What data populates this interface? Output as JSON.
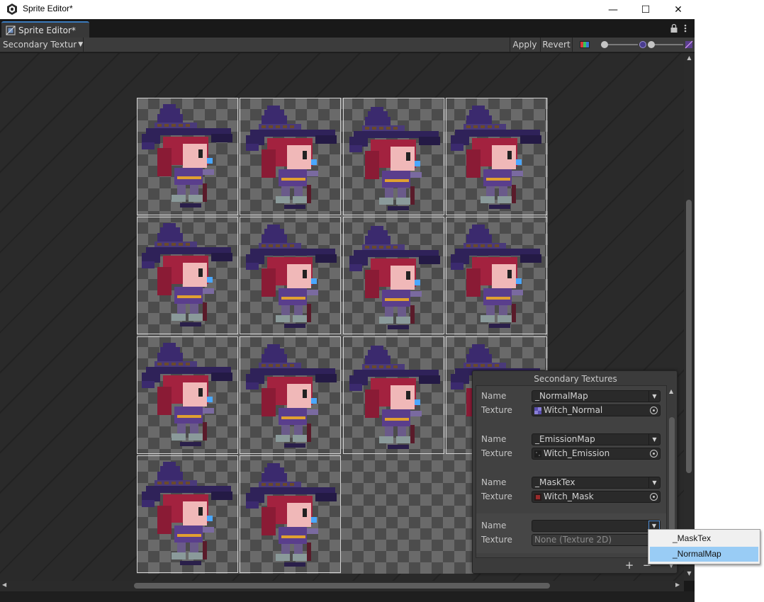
{
  "window": {
    "title": "Sprite Editor*",
    "minimize_glyph": "—",
    "maximize_glyph": "☐",
    "close_glyph": "✕"
  },
  "tab": {
    "label": "Sprite Editor*"
  },
  "toolbar": {
    "mode_label": "Secondary Textur",
    "apply_label": "Apply",
    "revert_label": "Revert"
  },
  "sprite_sheet": {
    "columns": 4,
    "rows": 4,
    "sprite_count": 14
  },
  "secondary_textures": {
    "title": "Secondary Textures",
    "name_label": "Name",
    "texture_label": "Texture",
    "entries": [
      {
        "name": "_NormalMap",
        "texture": "Witch_Normal",
        "thumb_color": "#8a7fd6"
      },
      {
        "name": "_EmissionMap",
        "texture": "Witch_Emission",
        "thumb_color": "#2a2a2a"
      },
      {
        "name": "_MaskTex",
        "texture": "Witch_Mask",
        "thumb_color": "#9a2a2a"
      },
      {
        "name": "",
        "texture": "None (Texture 2D)",
        "thumb_color": ""
      }
    ],
    "add_label": "+",
    "remove_label": "−"
  },
  "name_dropdown": {
    "options": [
      "_MaskTex",
      "_NormalMap"
    ],
    "highlighted": "_NormalMap"
  },
  "colors": {
    "accent": "#3a79bb",
    "hat": "#3b2a6e",
    "hair": "#a3223f",
    "skin": "#f0b8b8"
  }
}
